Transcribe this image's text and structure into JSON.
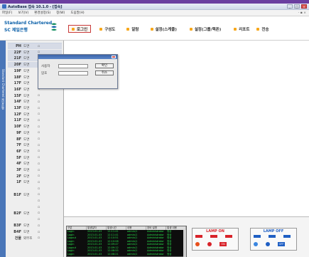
{
  "window": {
    "title": "AutoBase 접속 10.1.0 - [접속]",
    "controls": [
      "_",
      "□",
      "×"
    ]
  },
  "menu": {
    "items": [
      "파일(F)",
      "보기(V)",
      "환경설정(S)",
      "창(W)",
      "도움말(H)"
    ],
    "more": "- ▪ ×"
  },
  "logo": {
    "line1": "Standard Chartered",
    "line2": "SC 제일은행",
    "mark_color": "#0a8a5a"
  },
  "nav": {
    "items": [
      {
        "label": "로그인",
        "active": true
      },
      {
        "label": "구성도",
        "active": false
      },
      {
        "label": "알람",
        "active": false
      },
      {
        "label": "설정(스케줄)",
        "active": false
      },
      {
        "label": "설정(그룹/핵폰)",
        "active": false
      },
      {
        "label": "리포트",
        "active": false
      },
      {
        "label": "전송",
        "active": false
      }
    ]
  },
  "sidebar": {
    "label": "Standard Chartered 제일은행"
  },
  "floors": [
    {
      "name": "PH",
      "status": "도면",
      "icon": "▫"
    },
    {
      "name": "22F",
      "status": "도면",
      "icon": "▫"
    },
    {
      "name": "21F",
      "status": "도면",
      "icon": "▫"
    },
    {
      "name": "20F",
      "status": "도면",
      "icon": "▫"
    },
    {
      "name": "19F",
      "status": "도면",
      "icon": "▫"
    },
    {
      "name": "18F",
      "status": "도면",
      "icon": "▫"
    },
    {
      "name": "17F",
      "status": "도면",
      "icon": "▫"
    },
    {
      "name": "16F",
      "status": "도면",
      "icon": "▫"
    },
    {
      "name": "15F",
      "status": "도면",
      "icon": "▫"
    },
    {
      "name": "14F",
      "status": "도면",
      "icon": "▫"
    },
    {
      "name": "13F",
      "status": "도면",
      "icon": "▫"
    },
    {
      "name": "12F",
      "status": "도면",
      "icon": "▫"
    },
    {
      "name": "11F",
      "status": "도면",
      "icon": "▫"
    },
    {
      "name": "10F",
      "status": "도면",
      "icon": "▫"
    },
    {
      "name": "9F",
      "status": "도면",
      "icon": "▫"
    },
    {
      "name": "8F",
      "status": "도면",
      "icon": "▫"
    },
    {
      "name": "7F",
      "status": "도면",
      "icon": "▫"
    },
    {
      "name": "6F",
      "status": "도면",
      "icon": "▫"
    },
    {
      "name": "5F",
      "status": "도면",
      "icon": "▫"
    },
    {
      "name": "4F",
      "status": "도면",
      "icon": "▫"
    },
    {
      "name": "3F",
      "status": "도면",
      "icon": "▫"
    },
    {
      "name": "2F",
      "status": "도면",
      "icon": "▫"
    },
    {
      "name": "1F",
      "status": "도면",
      "icon": "▫"
    },
    {
      "name": "",
      "status": "",
      "icon": "▫"
    },
    {
      "name": "B1F",
      "status": "도면",
      "icon": "▫"
    },
    {
      "name": "",
      "status": "",
      "icon": "▫"
    },
    {
      "name": "",
      "status": "",
      "icon": "▫"
    },
    {
      "name": "B2F",
      "status": "도면",
      "icon": "▫"
    },
    {
      "name": "",
      "status": "",
      "icon": "▫"
    },
    {
      "name": "B3F",
      "status": "도면",
      "icon": "▫"
    },
    {
      "name": "B4F",
      "status": "도면",
      "icon": "▫"
    },
    {
      "name": "건물",
      "status": "외부조",
      "icon": "▫"
    }
  ],
  "login_dialog": {
    "user_label": "사용자",
    "password_label": "암호",
    "user_value": "",
    "password_value": "",
    "ok_label": "확인",
    "cancel_label": "취소"
  },
  "events": {
    "headers": [
      "구분",
      "발생일자",
      "발생시간",
      "내용",
      "장비 설명",
      "발생 내용"
    ],
    "rows": [
      [
        "Login",
        "2013-01-03",
        "12:11:41",
        "admin/1",
        "Administrator",
        "정상"
      ],
      [
        "Login",
        "2013-01-03",
        "12:11:41",
        "admin/1",
        "Administrator",
        "정상"
      ],
      [
        "Logout",
        "2013-01-03",
        "12:10:51",
        "admin/1",
        "Administrator",
        "정상"
      ],
      [
        "Login",
        "2013-01-03",
        "12:10:08",
        "admin/1",
        "Administrator",
        "정상"
      ],
      [
        "Login",
        "2013-01-03",
        "12:09:47",
        "admin/1",
        "Administrator",
        "정상"
      ],
      [
        "Logout",
        "2013-01-03",
        "12:09:12",
        "admin/1",
        "Administrator",
        "정상"
      ],
      [
        "Login",
        "2013-01-03",
        "12:08:55",
        "admin/1",
        "Administrator",
        "정상"
      ],
      [
        "Login",
        "2013-01-03",
        "12:08:21",
        "admin/1",
        "Administrator",
        "정상"
      ]
    ]
  },
  "lamp_on": {
    "title": "LAMP ON",
    "chip_color": "#d8232a",
    "chip_label": "ON"
  },
  "lamp_off": {
    "title": "LAMP OFF",
    "chip_color": "#1f5fc4",
    "chip_label": "OFF"
  },
  "colors": {
    "accent_purple": "#6b3fa0",
    "nav_bullet": "#f7a71b",
    "active_border": "#c83a3a",
    "event_text": "#28e04a"
  }
}
